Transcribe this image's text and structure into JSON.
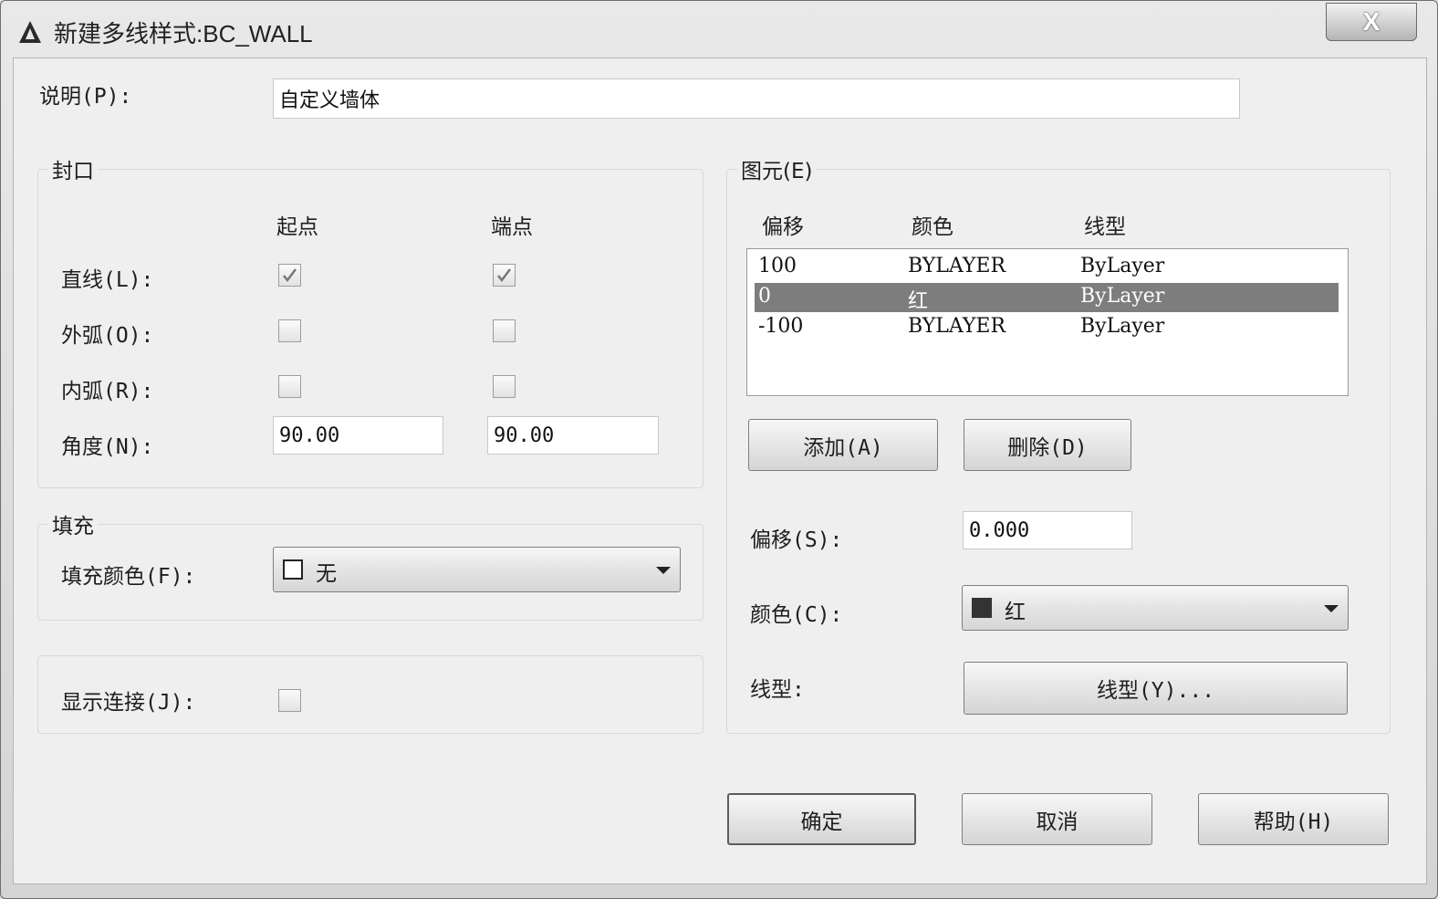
{
  "window": {
    "title": "新建多线样式:BC_WALL",
    "close_glyph": "X"
  },
  "description": {
    "label": "说明(P):",
    "value": "自定义墙体"
  },
  "caps": {
    "group_title": "封口",
    "col_start": "起点",
    "col_end": "端点",
    "line_label": "直线(L):",
    "outer_arc_label": "外弧(O):",
    "inner_arc_label": "内弧(R):",
    "angle_label": "角度(N):",
    "line_start_checked": true,
    "line_end_checked": true,
    "outer_arc_start_checked": false,
    "outer_arc_end_checked": false,
    "inner_arc_start_checked": false,
    "inner_arc_end_checked": false,
    "angle_start": "90.00",
    "angle_end": "90.00"
  },
  "fill": {
    "group_title": "填充",
    "label": "填充颜色(F):",
    "value": "无",
    "swatch_color": "#ffffff"
  },
  "joints": {
    "label": "显示连接(J):",
    "checked": false
  },
  "elements": {
    "group_title": "图元(E)",
    "headers": [
      "偏移",
      "颜色",
      "线型"
    ],
    "rows": [
      {
        "offset": "100",
        "color": "BYLAYER",
        "linetype": "ByLayer"
      },
      {
        "offset": "0",
        "color": "红",
        "linetype": "ByLayer",
        "selected": true
      },
      {
        "offset": "-100",
        "color": "BYLAYER",
        "linetype": "ByLayer"
      }
    ],
    "add_label": "添加(A)",
    "delete_label": "删除(D)",
    "offset_label": "偏移(S):",
    "offset_value": "0.000",
    "color_label": "颜色(C):",
    "color_value": "红",
    "color_swatch": "#333333",
    "linetype_label": "线型:",
    "linetype_button": "线型(Y)..."
  },
  "footer": {
    "ok": "确定",
    "cancel": "取消",
    "help": "帮助(H)"
  },
  "colors": {
    "selection": "#7d7d7d",
    "client_bg": "#efefef"
  }
}
